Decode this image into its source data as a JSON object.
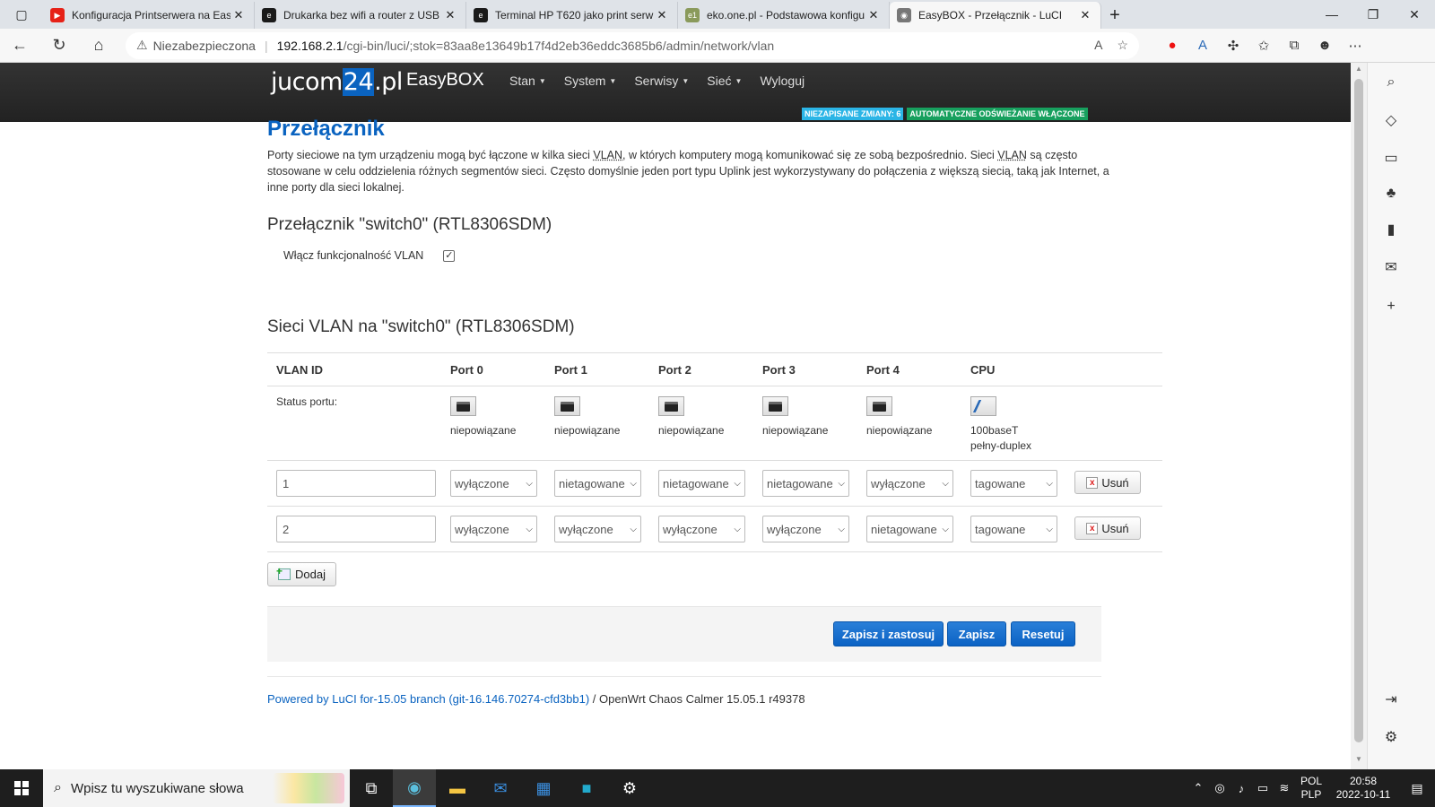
{
  "browser": {
    "tabs": [
      {
        "title": "Konfiguracja Printserwera na Eas",
        "color": "#e62117",
        "glyph": "▶"
      },
      {
        "title": "Drukarka bez wifi a router z USB",
        "color": "#1a1a1a",
        "glyph": "e"
      },
      {
        "title": "Terminal HP T620 jako print serw",
        "color": "#1a1a1a",
        "glyph": "e"
      },
      {
        "title": "eko.one.pl - Podstawowa konfigu",
        "color": "#8a9a5b",
        "glyph": "e1"
      },
      {
        "title": "EasyBOX - Przełącznik - LuCI",
        "color": "#777",
        "glyph": "◉"
      }
    ],
    "address": {
      "security_label": "Niezabezpieczona",
      "host": "192.168.2.1",
      "path": "/cgi-bin/luci/;stok=83aa8e13649b17f4d2eb36eddc3685b6/admin/network/vlan"
    }
  },
  "header": {
    "logo_pre": "jucom",
    "logo_hl": "24",
    "logo_post": ".pl",
    "brand": "EasyBOX",
    "menu": [
      "Stan",
      "System",
      "Serwisy",
      "Sieć",
      "Wyloguj"
    ],
    "badges": {
      "unsaved": "NIEZAPISANE ZMIANY: 6",
      "autorefresh": "AUTOMATYCZNE ODŚWIEŻANIE WŁĄCZONE"
    }
  },
  "main": {
    "title": "Przełącznik",
    "desc_1": "Porty sieciowe na tym urządzeniu mogą być łączone w kilka sieci ",
    "desc_abbr_1": "VLAN",
    "desc_2": ", w których komputery mogą komunikować się ze sobą bezpośrednio. Sieci ",
    "desc_abbr_2": "VLAN",
    "desc_3": " są często stosowane w celu oddzielenia różnych segmentów sieci. Często domyślnie jeden port typu Uplink jest wykorzystywany do połączenia z większą siecią, taką jak Internet, a inne porty dla sieci lokalnej.",
    "switch_heading": "Przełącznik \"switch0\" (RTL8306SDM)",
    "vlan_toggle_label": "Włącz funkcjonalność VLAN",
    "vlan_enabled": true,
    "vlans_heading": "Sieci VLAN na \"switch0\" (RTL8306SDM)",
    "table": {
      "headers": [
        "VLAN ID",
        "Port 0",
        "Port 1",
        "Port 2",
        "Port 3",
        "Port 4",
        "CPU"
      ],
      "status_label": "Status portu:",
      "port_status": [
        [
          "niepowiązane",
          ""
        ],
        [
          "niepowiązane",
          ""
        ],
        [
          "niepowiązane",
          ""
        ],
        [
          "niepowiązane",
          ""
        ],
        [
          "niepowiązane",
          ""
        ],
        [
          "100baseT",
          "pełny-duplex"
        ]
      ],
      "rows": [
        {
          "id": "1",
          "ports": [
            "wyłączone",
            "nietagowane",
            "nietagowane",
            "nietagowane",
            "wyłączone",
            "tagowane"
          ]
        },
        {
          "id": "2",
          "ports": [
            "wyłączone",
            "wyłączone",
            "wyłączone",
            "wyłączone",
            "nietagowane",
            "tagowane"
          ]
        }
      ],
      "delete_label": "Usuń"
    },
    "add_label": "Dodaj",
    "actions": {
      "save_apply": "Zapisz i zastosuj",
      "save": "Zapisz",
      "reset": "Resetuj"
    },
    "footer": {
      "link": "Powered by LuCI for-15.05 branch (git-16.146.70274-cfd3bb1)",
      "rest": " / OpenWrt Chaos Calmer 15.05.1 r49378"
    }
  },
  "taskbar": {
    "search_placeholder": "Wpisz tu wyszukiwane słowa",
    "lang_1": "POL",
    "lang_2": "PLP",
    "time": "20:58",
    "date": "2022-10-11"
  },
  "colors": {
    "accent": "#0a63c0",
    "badge_unsaved": "#2bb5e6",
    "badge_refresh": "#17a05e"
  }
}
